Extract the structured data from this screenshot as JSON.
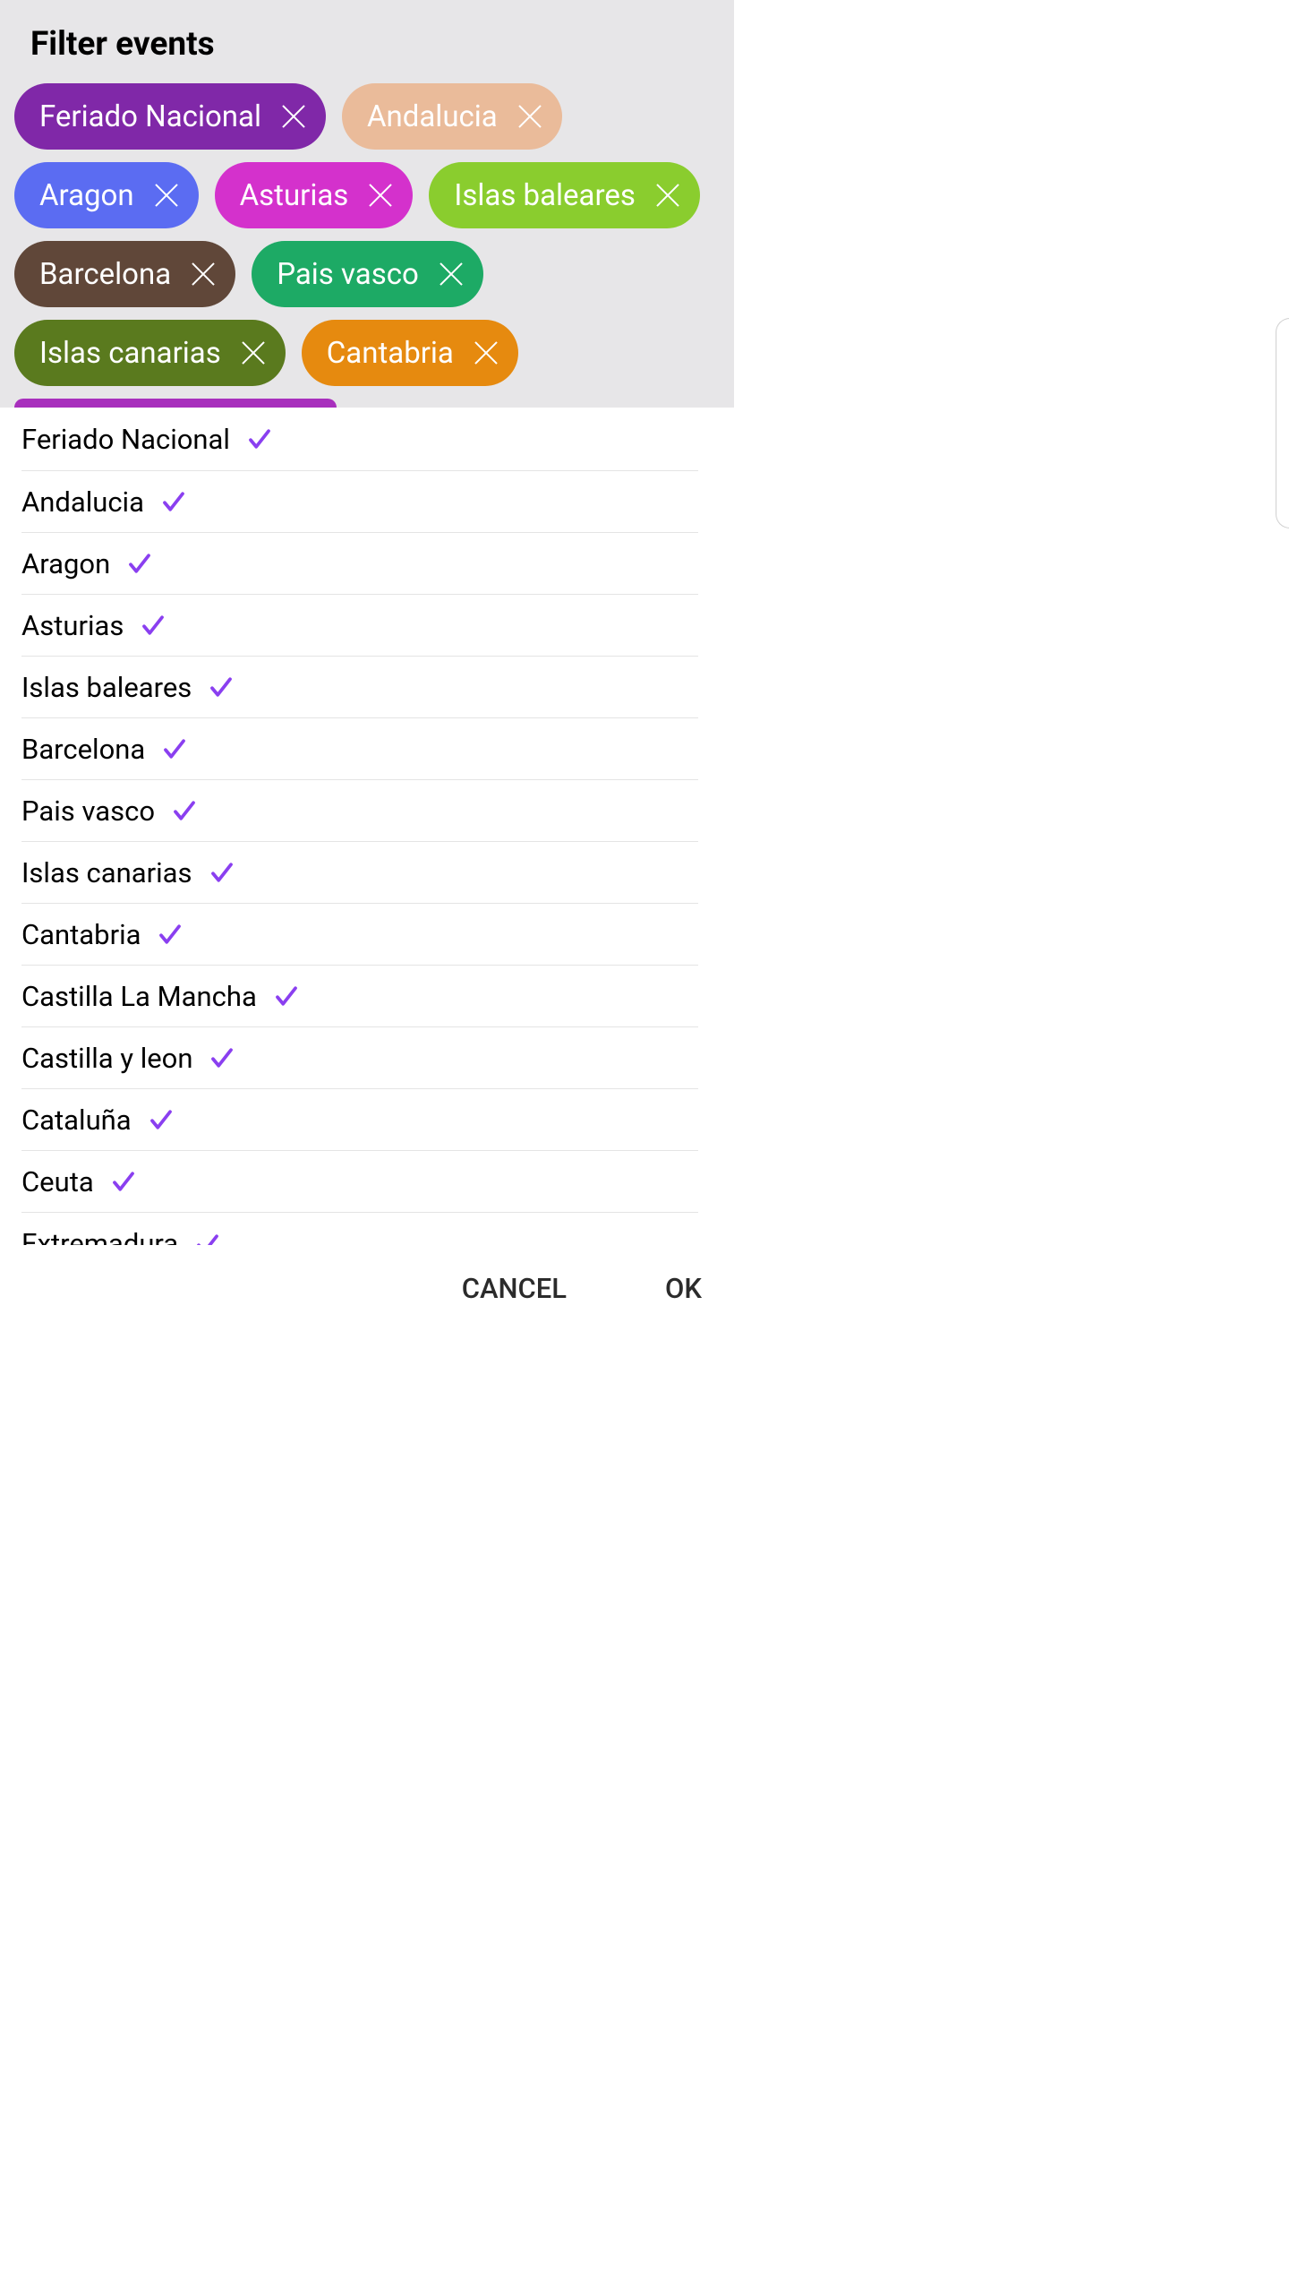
{
  "title": "Filter events",
  "check_color": "#8a3ff0",
  "chips": [
    {
      "label": "Feriado Nacional",
      "color": "#8028a8"
    },
    {
      "label": "Andalucia",
      "color": "#eabb9a"
    },
    {
      "label": "Aragon",
      "color": "#5b6cf2"
    },
    {
      "label": "Asturias",
      "color": "#d431cc"
    },
    {
      "label": "Islas baleares",
      "color": "#8acd2e"
    },
    {
      "label": "Barcelona",
      "color": "#604739"
    },
    {
      "label": "Pais vasco",
      "color": "#1daa65"
    },
    {
      "label": "Islas canarias",
      "color": "#5a7a1e"
    },
    {
      "label": "Cantabria",
      "color": "#e68a0f"
    }
  ],
  "list": [
    {
      "label": "Feriado Nacional",
      "checked": true
    },
    {
      "label": "Andalucia",
      "checked": true
    },
    {
      "label": "Aragon",
      "checked": true
    },
    {
      "label": "Asturias",
      "checked": true
    },
    {
      "label": "Islas baleares",
      "checked": true
    },
    {
      "label": "Barcelona",
      "checked": true
    },
    {
      "label": "Pais vasco",
      "checked": true
    },
    {
      "label": "Islas canarias",
      "checked": true
    },
    {
      "label": "Cantabria",
      "checked": true
    },
    {
      "label": "Castilla La Mancha",
      "checked": true
    },
    {
      "label": "Castilla y leon",
      "checked": true
    },
    {
      "label": "Cataluña",
      "checked": true
    },
    {
      "label": "Ceuta",
      "checked": true
    }
  ],
  "list_cut": {
    "label": "Extremadura",
    "checked": true
  },
  "actions": {
    "cancel": "CANCEL",
    "ok": "OK"
  }
}
